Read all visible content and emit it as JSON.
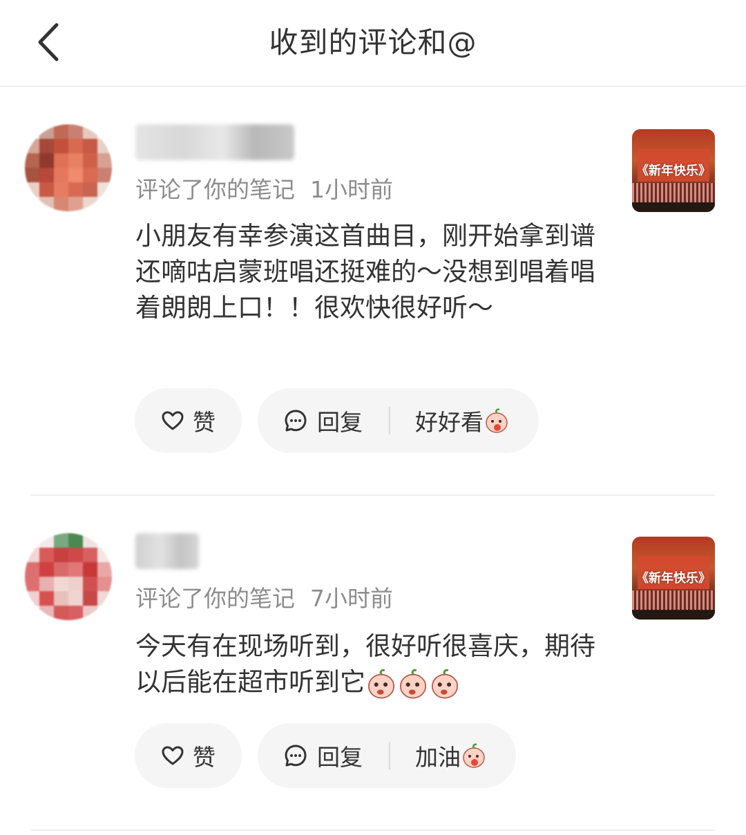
{
  "header": {
    "title": "收到的评论和@"
  },
  "comments": [
    {
      "action": "评论了你的笔记",
      "time": "1小时前",
      "text": "小朋友有幸参演这首曲目，刚开始拿到谱还嘀咕启蒙班唱还挺难的～没想到唱着唱着朗朗上口！！很欢快很好听～",
      "note_thumb_caption": "《新年快乐》",
      "like_label": "赞",
      "reply_label": "回复",
      "quick_reply": "好好看"
    },
    {
      "action": "评论了你的笔记",
      "time": "7小时前",
      "text": "今天有在现场听到，很好听很喜庆，期待以后能在超市听到它",
      "note_thumb_caption": "《新年快乐》",
      "like_label": "赞",
      "reply_label": "回复",
      "quick_reply": "加油"
    }
  ],
  "icons": {
    "back": "chevron-left-icon",
    "like": "heart-outline-icon",
    "reply": "chat-bubble-icon",
    "emoji": "peach-face-emoji"
  },
  "colors": {
    "text_primary": "#333333",
    "text_secondary": "#8c8c8c",
    "pill_bg": "#f5f5f5",
    "divider": "#eeeeee"
  }
}
